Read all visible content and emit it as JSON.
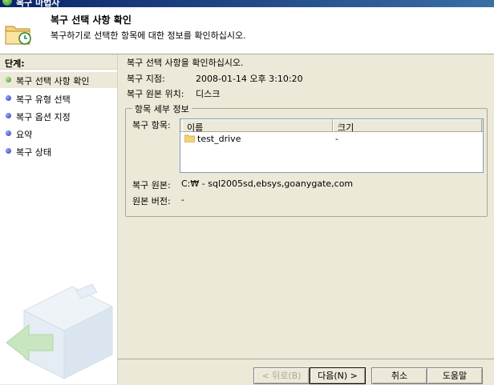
{
  "window": {
    "title": "복구 마법사"
  },
  "header": {
    "title": "복구 선택 사항 확인",
    "subtitle": "복구하기로 선택한 항목에 대한 정보를 확인하십시오."
  },
  "steps": {
    "heading": "단계:",
    "items": [
      {
        "label": "복구 선택 사항 확인",
        "active": true
      },
      {
        "label": "복구 유형 선택"
      },
      {
        "label": "복구 옵션 지정"
      },
      {
        "label": "요약"
      },
      {
        "label": "복구 상태"
      }
    ]
  },
  "main": {
    "instruction": "복구 선택 사항을 확인하십시오.",
    "recovery_point_label": "복구 지점:",
    "recovery_point_value": "2008-01-14 오후 3:10:20",
    "source_location_label": "복구 원본 위치:",
    "source_location_value": "디스크",
    "details": {
      "legend": "항목 세부 정보",
      "items_label": "복구 항목:",
      "columns": {
        "name": "이름",
        "size": "크기"
      },
      "rows": [
        {
          "name": "test_drive",
          "size": "-"
        }
      ],
      "source_label": "복구 원본:",
      "source_value": "C:₩ - sql2005sd,ebsys,goanygate,com",
      "version_label": "원본 버전:",
      "version_value": "-"
    }
  },
  "buttons": {
    "back": "< 뒤로(B)",
    "next": "다음(N) >",
    "cancel": "취소",
    "help": "도움말"
  },
  "icons": {
    "title": "wizard-app-icon",
    "header": "folder-clock-icon",
    "step": "bullet-icon",
    "folder": "folder-icon",
    "sort": "sort-ascending-icon"
  }
}
